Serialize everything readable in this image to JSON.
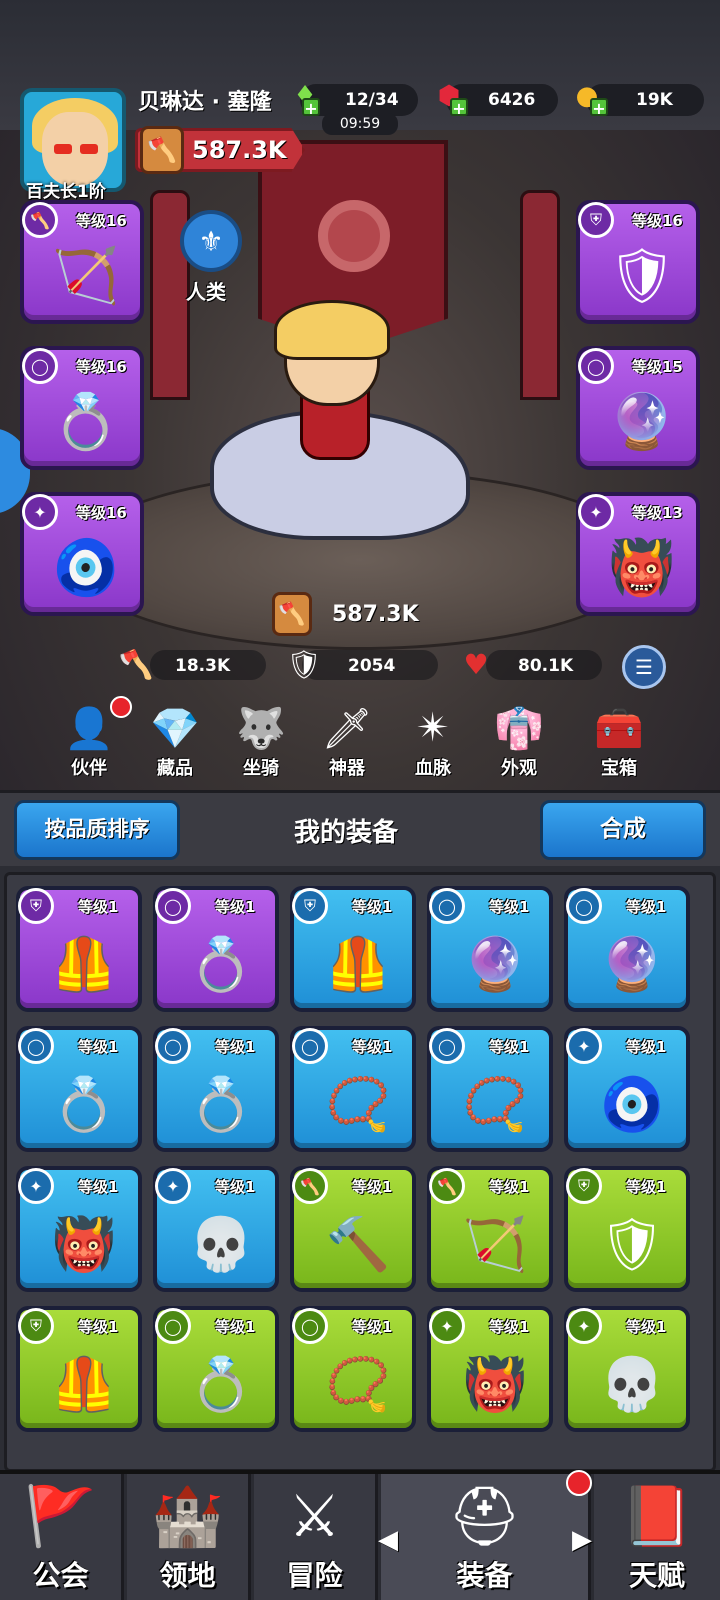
{
  "player": {
    "name": "贝琳达 · 塞隆",
    "rank": "百夫长1阶",
    "power": "587.3K"
  },
  "resources": {
    "energy": "12/34",
    "energy_timer": "09:59",
    "gems": "6426",
    "gold": "19K"
  },
  "hero": {
    "race": "人类",
    "total_power": "587.3K",
    "attack": "18.3K",
    "defense": "2054",
    "hp": "80.1K"
  },
  "equipped": [
    {
      "slot": "weapon",
      "level": "等级16",
      "icon": "crossbow-icon",
      "glyph": "🏹"
    },
    {
      "slot": "ring",
      "level": "等级16",
      "icon": "ring-icon",
      "glyph": "💍"
    },
    {
      "slot": "amulet",
      "level": "等级16",
      "icon": "amulet-icon",
      "glyph": "🧿"
    },
    {
      "slot": "armor",
      "level": "等级16",
      "icon": "armor-icon",
      "glyph": "🛡"
    },
    {
      "slot": "ring2",
      "level": "等级15",
      "icon": "orb-ring-icon",
      "glyph": "🔮"
    },
    {
      "slot": "helmet",
      "level": "等级13",
      "icon": "mask-icon",
      "glyph": "👹"
    }
  ],
  "features": [
    {
      "label": "伙伴",
      "icon": "companion-icon",
      "glyph": "👤"
    },
    {
      "label": "藏品",
      "icon": "collection-icon",
      "glyph": "💎"
    },
    {
      "label": "坐骑",
      "icon": "mount-icon",
      "glyph": "🐺"
    },
    {
      "label": "神器",
      "icon": "artifact-icon",
      "glyph": "🗡"
    },
    {
      "label": "血脉",
      "icon": "bloodline-icon",
      "glyph": "✴"
    },
    {
      "label": "外观",
      "icon": "appearance-icon",
      "glyph": "👘"
    },
    {
      "label": "宝箱",
      "icon": "chest-icon",
      "glyph": "🧰"
    }
  ],
  "equipment_panel": {
    "sort_button": "按品质排序",
    "title": "我的装备",
    "merge_button": "合成"
  },
  "inventory": [
    {
      "quality": "purple",
      "level": "等级1",
      "icon": "armor-icon",
      "glyph": "🦺"
    },
    {
      "quality": "purple",
      "level": "等级1",
      "icon": "ring-icon",
      "glyph": "💍"
    },
    {
      "quality": "blue",
      "level": "等级1",
      "icon": "armor-icon",
      "glyph": "🦺"
    },
    {
      "quality": "blue",
      "level": "等级1",
      "icon": "orb-ring-icon",
      "glyph": "🔮"
    },
    {
      "quality": "blue",
      "level": "等级1",
      "icon": "orb-ring-icon",
      "glyph": "🔮"
    },
    {
      "quality": "blue",
      "level": "等级1",
      "icon": "ring-icon",
      "glyph": "💍"
    },
    {
      "quality": "blue",
      "level": "等级1",
      "icon": "ring-icon",
      "glyph": "💍"
    },
    {
      "quality": "blue",
      "level": "等级1",
      "icon": "gem-ring-icon",
      "glyph": "📿"
    },
    {
      "quality": "blue",
      "level": "等级1",
      "icon": "gem-ring-icon",
      "glyph": "📿"
    },
    {
      "quality": "blue",
      "level": "等级1",
      "icon": "amulet-icon",
      "glyph": "🧿"
    },
    {
      "quality": "blue",
      "level": "等级1",
      "icon": "mask-icon",
      "glyph": "👹"
    },
    {
      "quality": "blue",
      "level": "等级1",
      "icon": "skull-mask-icon",
      "glyph": "💀"
    },
    {
      "quality": "green",
      "level": "等级1",
      "icon": "hammer-icon",
      "glyph": "🔨"
    },
    {
      "quality": "green",
      "level": "等级1",
      "icon": "crossbow-icon",
      "glyph": "🏹"
    },
    {
      "quality": "green",
      "level": "等级1",
      "icon": "armor-icon",
      "glyph": "🛡"
    },
    {
      "quality": "green",
      "level": "等级1",
      "icon": "armor-icon",
      "glyph": "🦺"
    },
    {
      "quality": "green",
      "level": "等级1",
      "icon": "ring-icon",
      "glyph": "💍"
    },
    {
      "quality": "green",
      "level": "等级1",
      "icon": "gem-ring-icon",
      "glyph": "📿"
    },
    {
      "quality": "green",
      "level": "等级1",
      "icon": "mask-icon",
      "glyph": "👹"
    },
    {
      "quality": "green",
      "level": "等级1",
      "icon": "skull-mask-icon",
      "glyph": "💀"
    }
  ],
  "bottom_nav": [
    {
      "label": "公会",
      "icon": "guild-banner-icon",
      "glyph": "🚩"
    },
    {
      "label": "领地",
      "icon": "castle-icon",
      "glyph": "🏰"
    },
    {
      "label": "冒险",
      "icon": "crossed-axes-icon",
      "glyph": "⚔"
    },
    {
      "label": "装备",
      "icon": "helmet-icon",
      "glyph": "⛑"
    },
    {
      "label": "天赋",
      "icon": "spellbook-icon",
      "glyph": "📕"
    }
  ],
  "colors": {
    "purple_quality": "#9b47d8",
    "blue_quality": "#2ea6e6",
    "green_quality": "#8cc92a",
    "accent_red": "#c2323a",
    "button_blue": "#2a8ee0"
  }
}
